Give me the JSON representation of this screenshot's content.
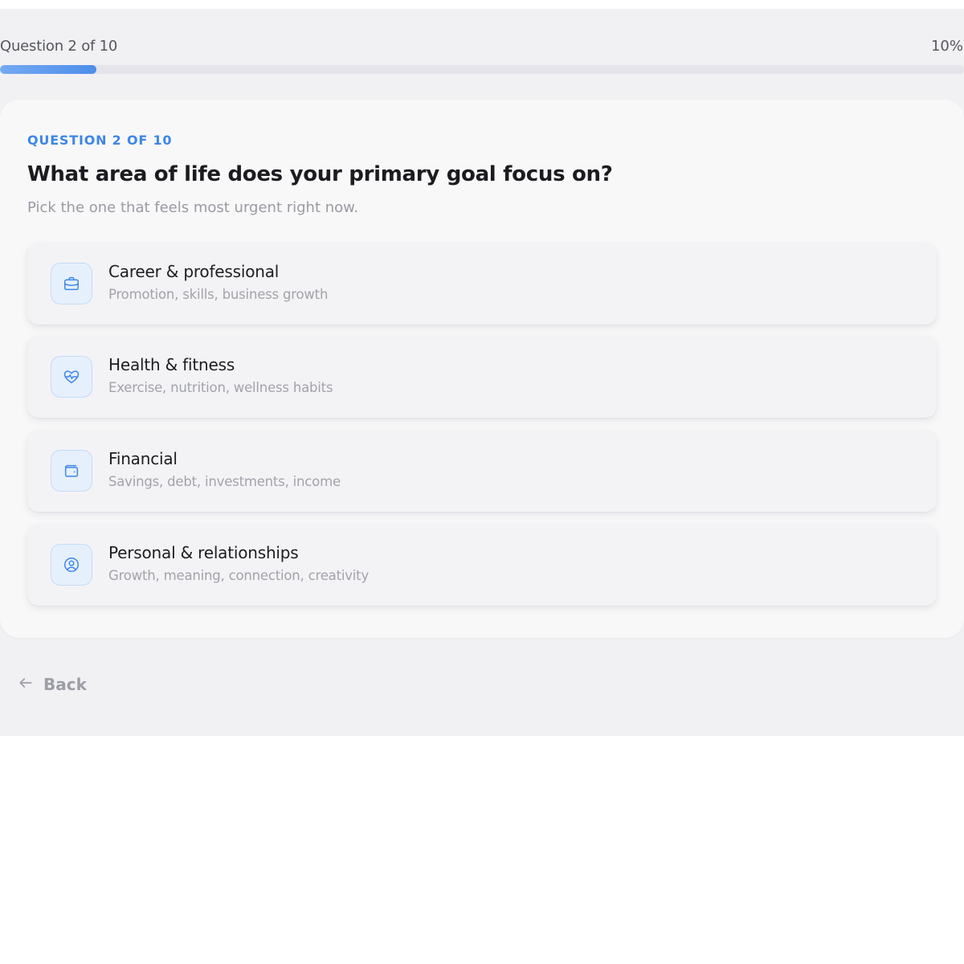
{
  "progress": {
    "label": "Question 2 of 10",
    "percent_label": "10%",
    "value": 0.1,
    "fill_color": "#4d8ee9"
  },
  "question": {
    "eyebrow": "QUESTION 2 OF 10",
    "title": "What area of life does your primary goal focus on?",
    "subtitle": "Pick the one that feels most urgent right now."
  },
  "options": [
    {
      "icon": "briefcase-icon",
      "title": "Career & professional",
      "description": "Promotion, skills, business growth"
    },
    {
      "icon": "heart-pulse-icon",
      "title": "Health & fitness",
      "description": "Exercise, nutrition, wellness habits"
    },
    {
      "icon": "wallet-icon",
      "title": "Financial",
      "description": "Savings, debt, investments, income"
    },
    {
      "icon": "user-circle-icon",
      "title": "Personal & relationships",
      "description": "Growth, meaning, connection, creativity"
    }
  ],
  "nav": {
    "back_label": "Back",
    "back_icon": "arrow-left-icon"
  },
  "colors": {
    "accent": "#3d86e6",
    "background": "#f1f1f4"
  }
}
